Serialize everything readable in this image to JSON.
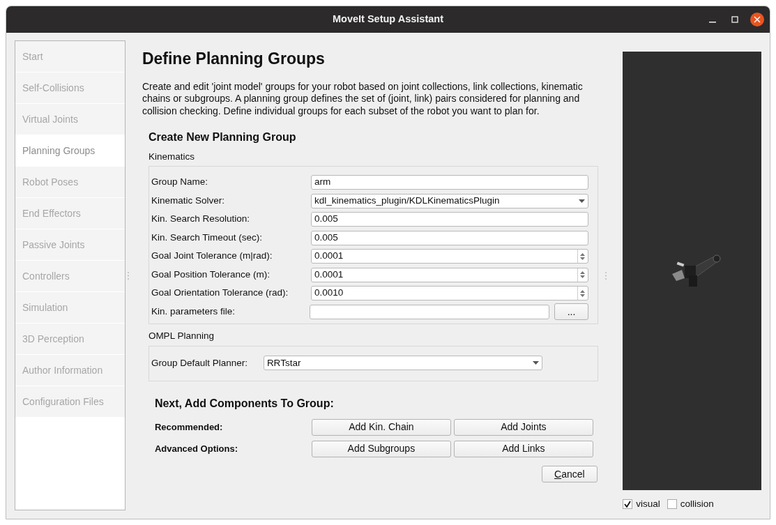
{
  "window": {
    "title": "MoveIt Setup Assistant"
  },
  "sidebar": {
    "items": [
      {
        "label": "Start",
        "selected": false
      },
      {
        "label": "Self-Collisions",
        "selected": false
      },
      {
        "label": "Virtual Joints",
        "selected": false
      },
      {
        "label": "Planning Groups",
        "selected": true
      },
      {
        "label": "Robot Poses",
        "selected": false
      },
      {
        "label": "End Effectors",
        "selected": false
      },
      {
        "label": "Passive Joints",
        "selected": false
      },
      {
        "label": "Controllers",
        "selected": false
      },
      {
        "label": "Simulation",
        "selected": false
      },
      {
        "label": "3D Perception",
        "selected": false
      },
      {
        "label": "Author Information",
        "selected": false
      },
      {
        "label": "Configuration Files",
        "selected": false
      }
    ]
  },
  "page": {
    "title": "Define Planning Groups",
    "description": "Create and edit 'joint model' groups for your robot based on joint collections, link collections, kinematic chains or subgroups. A planning group defines the set of (joint, link) pairs considered for planning and collision checking. Define individual groups for each subset of the robot you want to plan for."
  },
  "form": {
    "title": "Create New Planning Group",
    "kinematics": {
      "title": "Kinematics",
      "fields": [
        {
          "kind": "text",
          "label": "Group Name:",
          "value": "arm"
        },
        {
          "kind": "combo",
          "label": "Kinematic Solver:",
          "value": "kdl_kinematics_plugin/KDLKinematicsPlugin"
        },
        {
          "kind": "text",
          "label": "Kin. Search Resolution:",
          "value": "0.005"
        },
        {
          "kind": "text",
          "label": "Kin. Search Timeout (sec):",
          "value": "0.005"
        },
        {
          "kind": "spin",
          "label": "Goal Joint Tolerance (m|rad):",
          "value": "0.0001"
        },
        {
          "kind": "spin",
          "label": "Goal Position Tolerance (m):",
          "value": "0.0001"
        },
        {
          "kind": "spin",
          "label": "Goal Orientation Tolerance (rad):",
          "value": "0.0010"
        },
        {
          "kind": "file",
          "label": "Kin. parameters file:",
          "button": "..."
        }
      ]
    },
    "ompl": {
      "title": "OMPL Planning",
      "label": "Group Default Planner:",
      "value": "RRTstar"
    }
  },
  "components": {
    "title": "Next, Add Components To Group:",
    "rows": [
      {
        "label": "Recommended:",
        "buttons": [
          "Add Kin. Chain",
          "Add Joints"
        ]
      },
      {
        "label": "Advanced Options:",
        "buttons": [
          "Add Subgroups",
          "Add Links"
        ]
      }
    ]
  },
  "cancel": {
    "label": "Cancel"
  },
  "viewer": {
    "options": [
      {
        "label": "visual",
        "checked": true
      },
      {
        "label": "collision",
        "checked": false
      }
    ]
  }
}
